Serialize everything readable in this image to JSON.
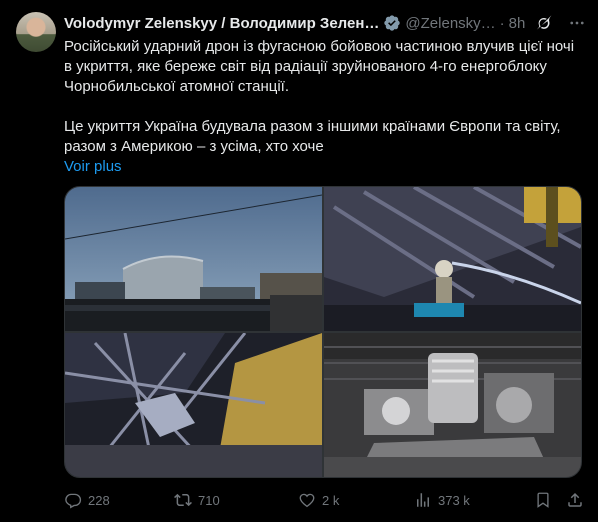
{
  "author": {
    "display_name": "Volodymyr Zelenskyy / Володимир Зелен…",
    "handle": "@Zelensky…",
    "separator": "·",
    "time": "8h"
  },
  "tweet": {
    "paragraph_1": "Російський ударний дрон із фугасною бойовою частиною влучив цієї ночі в укриття, яке береже світ від радіації зруйнованого 4-го енергоблоку Чорнобильської атомної станції.",
    "paragraph_2": "Це укриття Україна будувала разом з іншими країнами Європи та світу, разом з Америкою – з усіма, хто хоче",
    "show_more": "Voir plus"
  },
  "actions": {
    "replies": "228",
    "reposts": "710",
    "likes": "2 k",
    "views": "373 k"
  },
  "colors": {
    "background": "#000000",
    "text": "#e7e9ea",
    "muted": "#71767b",
    "accent": "#1d9bf0",
    "verified": "#829aab"
  },
  "icons": [
    "verified-badge-icon",
    "grok-icon",
    "more-icon",
    "reply-icon",
    "repost-icon",
    "like-icon",
    "views-icon",
    "bookmark-icon",
    "share-icon"
  ]
}
